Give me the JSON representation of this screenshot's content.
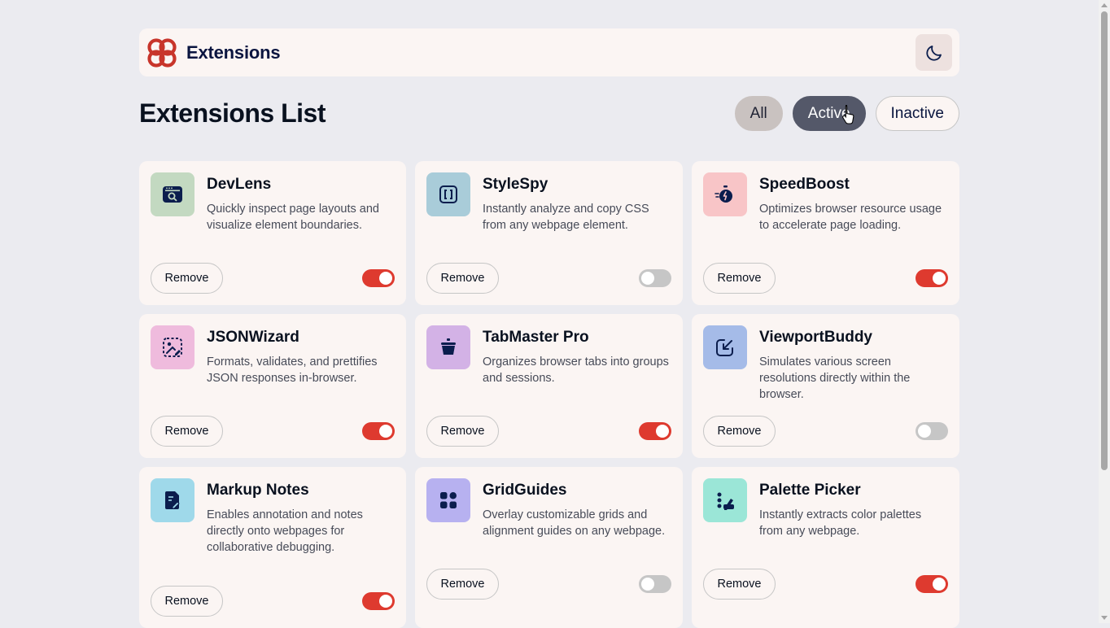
{
  "header": {
    "brand_name": "Extensions",
    "theme_icon": "moon-icon"
  },
  "toolbar": {
    "title": "Extensions List",
    "filters": [
      "All",
      "Active",
      "Inactive"
    ],
    "selected_filter": "Active"
  },
  "extensions": [
    {
      "name": "DevLens",
      "description": "Quickly inspect page layouts and visualize element boundaries.",
      "remove_label": "Remove",
      "enabled": true,
      "icon_bg": "#c3d9c1"
    },
    {
      "name": "StyleSpy",
      "description": "Instantly analyze and copy CSS from any webpage element.",
      "remove_label": "Remove",
      "enabled": false,
      "icon_bg": "#a9ccd9"
    },
    {
      "name": "SpeedBoost",
      "description": "Optimizes browser resource usage to accelerate page loading.",
      "remove_label": "Remove",
      "enabled": true,
      "icon_bg": "#f8c5c7"
    },
    {
      "name": "JSONWizard",
      "description": "Formats, validates, and prettifies JSON responses in-browser.",
      "remove_label": "Remove",
      "enabled": true,
      "icon_bg": "#efbbdd"
    },
    {
      "name": "TabMaster Pro",
      "description": "Organizes browser tabs into groups and sessions.",
      "remove_label": "Remove",
      "enabled": true,
      "icon_bg": "#d3b2e6"
    },
    {
      "name": "ViewportBuddy",
      "description": "Simulates various screen resolutions directly within the browser.",
      "remove_label": "Remove",
      "enabled": false,
      "icon_bg": "#a5bbe8"
    },
    {
      "name": "Markup Notes",
      "description": "Enables annotation and notes directly onto webpages for collaborative debugging.",
      "remove_label": "Remove",
      "enabled": true,
      "icon_bg": "#9fd9ea"
    },
    {
      "name": "GridGuides",
      "description": "Overlay customizable grids and alignment guides on any webpage.",
      "remove_label": "Remove",
      "enabled": false,
      "icon_bg": "#b7b1f0"
    },
    {
      "name": "Palette Picker",
      "description": "Instantly extracts color palettes from any webpage.",
      "remove_label": "Remove",
      "enabled": true,
      "icon_bg": "#9be6d7"
    }
  ],
  "colors": {
    "accent": "#de3a2f",
    "background": "#ebebf0",
    "card": "#fbf5f3",
    "icon_ink": "#0b1d4d"
  }
}
